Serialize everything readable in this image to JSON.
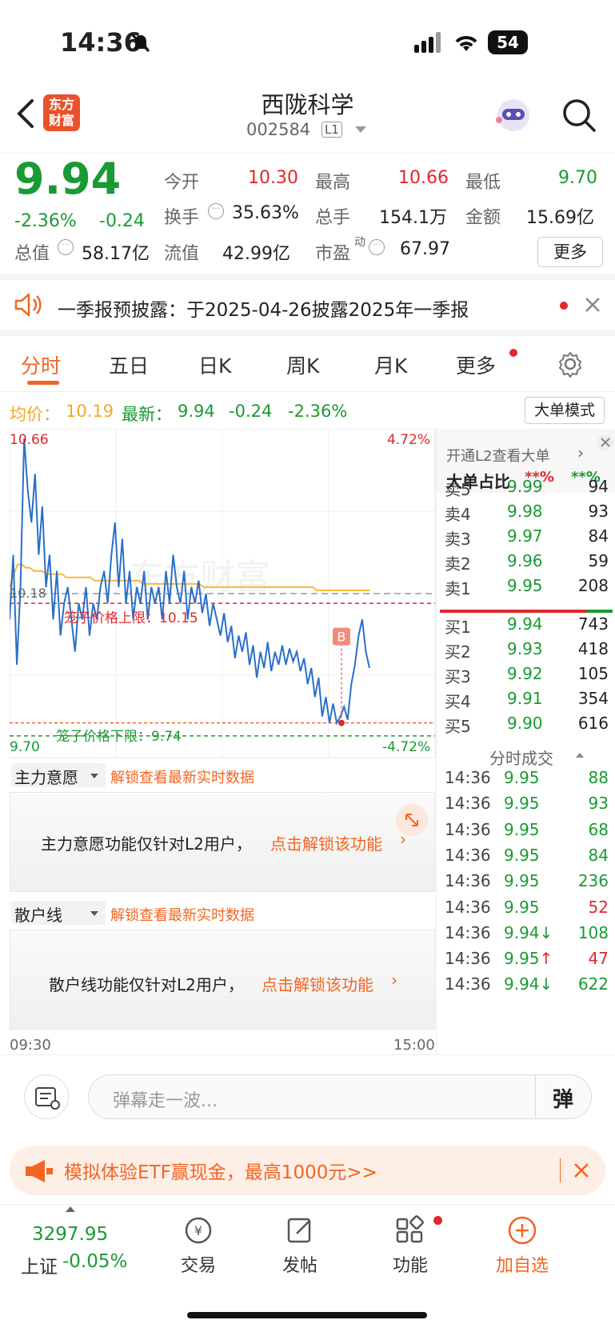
{
  "status": {
    "time": "14:36",
    "battery": "54"
  },
  "header": {
    "logo": "东方\n财富",
    "title": "西陇科学",
    "code": "002584",
    "level": "L1"
  },
  "quote": {
    "price": "9.94",
    "change_pct": "-2.36%",
    "change": "-0.24",
    "open_label": "今开",
    "open": "10.30",
    "high_label": "最高",
    "high": "10.66",
    "low_label": "最低",
    "low": "9.70",
    "turnover_label": "换手",
    "turnover": "35.63%",
    "volume_label": "总手",
    "volume": "154.1万",
    "amount_label": "金额",
    "amount": "15.69亿",
    "mktcap_label": "总值",
    "mktcap": "58.17亿",
    "float_label": "流值",
    "float": "42.99亿",
    "pe_label": "市盈",
    "pe_sup": "动",
    "pe": "67.97",
    "more_label": "更多"
  },
  "notice": {
    "text": "一季报预披露：于2025-04-26披露2025年一季报"
  },
  "tabs": [
    "分时",
    "五日",
    "日K",
    "周K",
    "月K",
    "更多"
  ],
  "infoline": {
    "avg_label": "均价：",
    "avg": "10.19",
    "latest_label": "最新：",
    "latest": "9.94",
    "chg": "-0.24",
    "pct": "-2.36%",
    "mode_button": "大单模式"
  },
  "chart_data": {
    "type": "line",
    "y_top_label": "10.66",
    "y_bottom_label": "9.70",
    "pct_top": "4.72%",
    "pct_bottom": "-4.72%",
    "ref_label": "10.18",
    "upper_cage": "笼子价格上限：10.15",
    "lower_cage": "笼子价格下限：9.74",
    "buy_marker": "B",
    "ylim": [
      9.7,
      10.66
    ],
    "upper_cage_value": 10.15,
    "lower_cage_value": 9.74,
    "ref_value": 10.18,
    "x_start": "09:30",
    "x_end": "15:00",
    "price_series": [
      10.1,
      10.3,
      9.96,
      10.2,
      10.66,
      10.5,
      10.4,
      10.55,
      10.3,
      10.45,
      10.2,
      10.3,
      10.1,
      10.25,
      10.05,
      10.15,
      10.2,
      10.1,
      10.0,
      10.15,
      10.1,
      10.2,
      10.05,
      10.15,
      10.1,
      10.2,
      10.25,
      10.15,
      10.3,
      10.4,
      10.2,
      10.35,
      10.15,
      10.25,
      10.1,
      10.2,
      10.15,
      10.25,
      10.1,
      10.2,
      10.15,
      10.2,
      10.1,
      10.25,
      10.15,
      10.3,
      10.2,
      10.15,
      10.25,
      10.1,
      10.2,
      10.15,
      10.22,
      10.12,
      10.18,
      10.08,
      10.15,
      10.1,
      10.05,
      10.12,
      10.03,
      10.08,
      9.98,
      10.05,
      10.0,
      10.06,
      9.96,
      10.02,
      9.92,
      10.0,
      9.95,
      10.03,
      9.94,
      10.0,
      9.96,
      10.02,
      9.96,
      10.01,
      9.97,
      10.0,
      9.94,
      9.98,
      9.9,
      9.95,
      9.86,
      9.92,
      9.8,
      9.86,
      9.78,
      9.84,
      9.78,
      9.8,
      9.83,
      9.79,
      9.9,
      9.96,
      10.05,
      10.1,
      10.0,
      9.95
    ],
    "avg_series": [
      10.2,
      10.24,
      10.27,
      10.27,
      10.26,
      10.26,
      10.25,
      10.25,
      10.25,
      10.24,
      10.24,
      10.24,
      10.24,
      10.24,
      10.23,
      10.23,
      10.23,
      10.23,
      10.23,
      10.23,
      10.23,
      10.22,
      10.22,
      10.22,
      10.22,
      10.22,
      10.22,
      10.22,
      10.22,
      10.22,
      10.22,
      10.22,
      10.22,
      10.21,
      10.21,
      10.21,
      10.21,
      10.21,
      10.21,
      10.21,
      10.21,
      10.21,
      10.21,
      10.21,
      10.21,
      10.21,
      10.21,
      10.21,
      10.2,
      10.2,
      10.2,
      10.2,
      10.2,
      10.2,
      10.2,
      10.2,
      10.2,
      10.2,
      10.2,
      10.2,
      10.2,
      10.2,
      10.2,
      10.2,
      10.2,
      10.2,
      10.2,
      10.2,
      10.2,
      10.2,
      10.2,
      10.2,
      10.2,
      10.2,
      10.2,
      10.2,
      10.19,
      10.19,
      10.19,
      10.19,
      10.19,
      10.19,
      10.19,
      10.19,
      10.19,
      10.19,
      10.19,
      10.19,
      10.19,
      10.19
    ]
  },
  "sub1": {
    "select": "主力意愿",
    "unlock": "解锁查看最新实时数据",
    "msg": "主力意愿功能仅针对L2用户，",
    "link": "点击解锁该功能"
  },
  "sub2": {
    "select": "散户线",
    "unlock": "解锁查看最新实时数据",
    "msg": "散户线功能仅针对L2用户，",
    "link": "点击解锁该功能"
  },
  "side": {
    "l2_link": "开通L2查看大单",
    "big_ratio": "大单占比",
    "stars": "**%",
    "asks": [
      [
        "卖5",
        "9.99",
        "94"
      ],
      [
        "卖4",
        "9.98",
        "93"
      ],
      [
        "卖3",
        "9.97",
        "84"
      ],
      [
        "卖2",
        "9.96",
        "59"
      ],
      [
        "卖1",
        "9.95",
        "208"
      ]
    ],
    "bids": [
      [
        "买1",
        "9.94",
        "743"
      ],
      [
        "买2",
        "9.93",
        "418"
      ],
      [
        "买3",
        "9.92",
        "105"
      ],
      [
        "买4",
        "9.91",
        "354"
      ],
      [
        "买5",
        "9.90",
        "616"
      ]
    ],
    "trades_title": "分时成交",
    "trades": [
      [
        "14:36",
        "9.95",
        "88",
        "g"
      ],
      [
        "14:36",
        "9.95",
        "93",
        "g"
      ],
      [
        "14:36",
        "9.95",
        "68",
        "g"
      ],
      [
        "14:36",
        "9.95",
        "84",
        "g"
      ],
      [
        "14:36",
        "9.95",
        "236",
        "g"
      ],
      [
        "14:36",
        "9.95",
        "52",
        "r"
      ],
      [
        "14:36",
        "9.94↓",
        "108",
        "g"
      ],
      [
        "14:36",
        "9.95↑",
        "47",
        "r"
      ],
      [
        "14:36",
        "9.94↓",
        "622",
        "g"
      ]
    ]
  },
  "comment": {
    "placeholder": "弹幕走一波...",
    "btn": "弹"
  },
  "promo": {
    "text": "模拟体验ETF赢现金，最高1000元>>"
  },
  "dock": {
    "index_value": "3297.95",
    "index_name": "上证",
    "index_change": "-0.05%",
    "trade": "交易",
    "post": "发帖",
    "func": "功能",
    "add": "加自选"
  },
  "colors": {
    "up": "#e0282e",
    "down": "#1a9a33",
    "accent": "#f26522",
    "avg_line": "#f5b83d",
    "price_line": "#2b6fc9"
  }
}
